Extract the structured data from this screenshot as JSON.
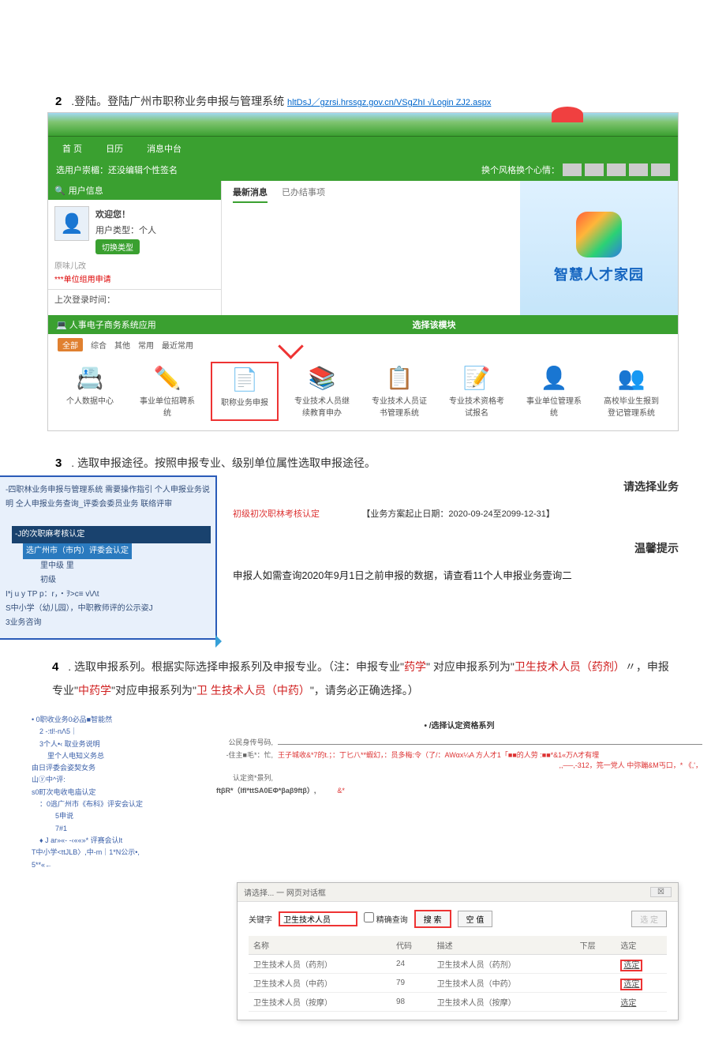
{
  "step2": {
    "num": "2",
    "title": ".登陆。登陆广州市职称业务申报与管理系统",
    "url": "hltDsJ／gzrsi.hrssgz.gov.cn/VSgZhI √Login ZJ2.aspx"
  },
  "portal": {
    "toolbar_tabs": [
      "首 页",
      "",
      "日历",
      "消息中台"
    ],
    "signature": "选用户崇楣：还没编辑个性签名",
    "right_hint": "换个风格换个心情：",
    "userinfo_hdr": "用户信息",
    "welcome": "欢迎您！",
    "usertype_label": "用户类型：",
    "usertype": "个人",
    "modify": "原味儿改",
    "switch_btn": "切换类型",
    "unit_apply": "***单位组用申请",
    "last_login": "上次登录时间：",
    "mid_tabs": [
      "最新消息",
      "已办结事项"
    ],
    "brand": "智慧人才家园",
    "module_bar": "人事电子商务系统应用",
    "module_select": "选择该模块",
    "filters": [
      "全部",
      "综合",
      "其他",
      "常用",
      "最近常用"
    ],
    "modules": [
      {
        "icon": "📇",
        "label": "个人数据中心"
      },
      {
        "icon": "✏️",
        "label": "事业单位招聘系统"
      },
      {
        "icon": "📄",
        "label": "职称业务申报"
      },
      {
        "icon": "📚",
        "label": "专业技术人员继续教育申办"
      },
      {
        "icon": "📋",
        "label": "专业技术人员证书管理系统"
      },
      {
        "icon": "📝",
        "label": "专业技术资格考试报名"
      },
      {
        "icon": "👤",
        "label": "事业单位管理系统"
      },
      {
        "icon": "👥",
        "label": "高校毕业生报到登记管理系统"
      }
    ]
  },
  "step3": {
    "num": "3",
    "title": " . 选取申报途径。按照申报专业、级别单位属性选取申报途径。",
    "tree_top": "-四职林业务申报与管理系统 需要操作指引 个人申报业务说明 仝人申报业务查询_评委会委员业务 联络评审",
    "tree_group": "-J的次职麻考核认定",
    "tree_sel": "选广州市（市内）评委会认定",
    "tree_items": [
      "里中级 里",
      "初级"
    ],
    "tree_other": "I*j u y TP p：r，・ｦ>c≡ v\\Λt\nS中小学（幼儿园），中职教师评的公示姿J\n3业务咨询",
    "main_title": "请选择业务",
    "red": "初级初次职林考核认定",
    "schedule": "【业务方案起止日期：2020-09-24至2099-12-31】",
    "tip_title": "温馨提示",
    "tip_body": "申报人如需查询2020年9月1日之前申报的数据，请查看11个人申报业务壹询二"
  },
  "step4": {
    "num": "4",
    "para": " . 选取申报系列。根据实际选择申报系列及申报专业。（注：申报专业\"",
    "red1": "药学",
    "mid1": "\" 对应申报系列为\"",
    "red2": "卫生技术人员（药剂）",
    "mid2": "〃，申报专业\"",
    "red3": "中药学",
    "mid3": "\"对应申报系列为\"",
    "red4": "卫 生技术人员（中药）",
    "end": "\"，请务必正确选择。）",
    "tree": [
      "• 0职收业务0必品■智能然",
      "2 -:tl!-nΛ5｜",
      "3个人•‹ 取业务说明",
      "里个人电知义务总",
      "由日评委会姿契女务",
      "山ⓨ中^评:",
      "s0町次电收电庙认定",
      "：0逃广州市《布科》评安会认定",
      "5申说",
      "7#1",
      "♦ J ar»«- -‹««»* 评赛会认lt",
      "T中小学<ttJLB〉,中-m｜1*N公示•,",
      "5**«←"
    ],
    "form_title": "• /选择认定资格系列",
    "id_label": "公民身传号码,",
    "reside_label": "-住主■毛*：忙,",
    "reside_red": "王子城收&*7的t.；：丁匕八**蝦幻，：员多梅:令（了/：AWαx¼A 方人才1「■■的人劳 :■■*&1«万Λ才有埋",
    "reside_more": ",,──,-312，笎一党人 中弥蹦&M丐口，* 《,'，",
    "series_label": "认定资*景列,",
    "ft_label": "ftβR*（IfI*ttSA0EΦ*βaβ9ftβ）,",
    "ft_red": "&*"
  },
  "dialog": {
    "title": "请选择... 一 网页对话框",
    "close": " ",
    "kw_label": "关键字",
    "kw_value": "卫生技术人员",
    "exact": "精确查询",
    "search_btn": "搜 索",
    "clear_btn": "空 值",
    "disabled_btn": "选 定",
    "cols": [
      "名称",
      "代码",
      "描述",
      "下层",
      "选定"
    ],
    "rows": [
      {
        "name": "卫生技术人员（药剂）",
        "code": "24",
        "desc": "卫生技术人员（药剂）",
        "next": "",
        "sel": "选定",
        "hi": true
      },
      {
        "name": "卫生技术人员（中药）",
        "code": "79",
        "desc": "卫生技术人员（中药）",
        "next": "",
        "sel": "选定",
        "hi": true
      },
      {
        "name": "卫生技术人员（按摩）",
        "code": "98",
        "desc": "卫生技术人员（按摩）",
        "next": "",
        "sel": "选定",
        "hi": false
      }
    ]
  }
}
